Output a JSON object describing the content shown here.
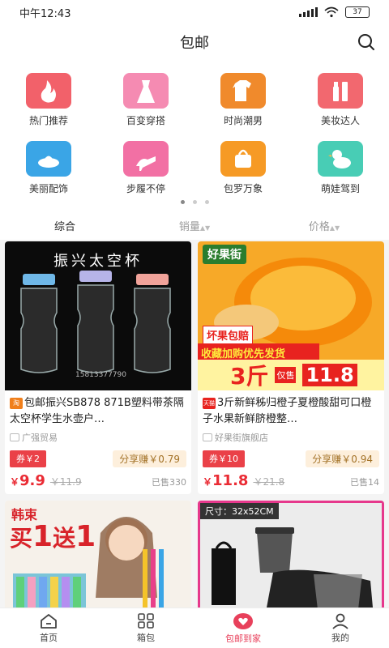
{
  "status": {
    "time": "中午12:43",
    "battery": "37"
  },
  "header": {
    "title": "包邮"
  },
  "categories": [
    {
      "label": "热门推荐",
      "icon": "fire-icon",
      "color": "#f2616a"
    },
    {
      "label": "百变穿搭",
      "icon": "dress-icon",
      "color": "#f58bb2"
    },
    {
      "label": "时尚潮男",
      "icon": "tshirt-icon",
      "color": "#f08a2c"
    },
    {
      "label": "美妆达人",
      "icon": "cosmetics-icon",
      "color": "#f2686f"
    },
    {
      "label": "美丽配饰",
      "icon": "hat-icon",
      "color": "#3aa5e6"
    },
    {
      "label": "步履不停",
      "icon": "high-heel-icon",
      "color": "#f270a4"
    },
    {
      "label": "包罗万象",
      "icon": "bag-icon",
      "color": "#f69a25"
    },
    {
      "label": "萌娃驾到",
      "icon": "duck-icon",
      "color": "#48cdb5"
    }
  ],
  "sort": {
    "default": "综合",
    "sales": "销量",
    "price": "价格"
  },
  "products": [
    {
      "platform": "淘",
      "platform_color": "#f07f1c",
      "title": "包邮振兴SB878  871B塑料带茶隔太空杯学生水壶户…",
      "shop": "广强贸易",
      "coupon": "券￥2",
      "share": "分享赚￥0.79",
      "price": "9.9",
      "orig": "￥11.9",
      "sold": "已售330",
      "image_text": "振兴太空杯",
      "image_phone": "15813377790"
    },
    {
      "platform": "天猫",
      "platform_color": "#e8231f",
      "title": "3斤新鲜秭归橙子夏橙酸甜可口橙子水果新鲜脐橙整…",
      "shop": "好果街旗舰店",
      "coupon": "券￥10",
      "share": "分享赚￥0.94",
      "price": "11.8",
      "orig": "￥21.8",
      "sold": "已售14",
      "image_brand": "好果街",
      "image_badge": "坏果包赔",
      "image_banner": "收藏加购优先发货",
      "image_weight": "3斤",
      "image_price_label": "仅售",
      "image_price": "11.8"
    },
    {
      "image_brand": "韩束",
      "image_promo_1": "买",
      "image_promo_num1": "1",
      "image_promo_2": "送",
      "image_promo_num2": "1"
    },
    {
      "image_size": "尺寸：32x52CM"
    }
  ],
  "tabs": [
    {
      "label": "首页",
      "icon": "home-icon"
    },
    {
      "label": "箱包",
      "icon": "grid-icon"
    },
    {
      "label": "包邮到家",
      "icon": "heart-icon"
    },
    {
      "label": "我的",
      "icon": "user-icon"
    }
  ],
  "colors": {
    "accent": "#e8405b",
    "price": "#ea2b34",
    "coupon": "#ea4148"
  }
}
